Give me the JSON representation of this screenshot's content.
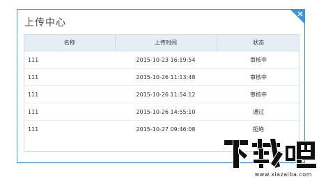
{
  "dialog": {
    "title": "上传中心",
    "columns": [
      "名称",
      "上传时间",
      "状态"
    ],
    "rows": [
      {
        "name": "111",
        "time": "2015-10-23 16:19:54",
        "status": "审核中"
      },
      {
        "name": "111",
        "time": "2015-10-26 11:13:48",
        "status": "审核中"
      },
      {
        "name": "111",
        "time": "2015-10-26 11:54:12",
        "status": "审核中"
      },
      {
        "name": "111",
        "time": "2015-10-26 14:55:10",
        "status": "通过"
      },
      {
        "name": "111",
        "time": "2015-10-27 09:46:08",
        "status": "拒绝"
      }
    ],
    "accent_color": "#3b97dc"
  },
  "watermark": {
    "logo_text": "下载吧",
    "url": "www.xiazaiba.com"
  }
}
